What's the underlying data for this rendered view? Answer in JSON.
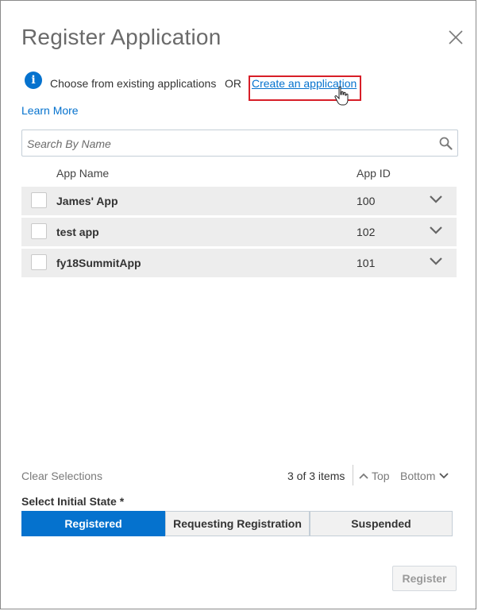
{
  "dialog": {
    "title": "Register Application"
  },
  "info": {
    "choose_text": "Choose from existing applications",
    "or_text": "OR",
    "create_link": "Create an application",
    "learn_more": "Learn More"
  },
  "search": {
    "placeholder": "Search By Name",
    "value": ""
  },
  "table": {
    "columns": [
      "App Name",
      "App ID"
    ],
    "rows": [
      {
        "name": "James' App",
        "id": "100"
      },
      {
        "name": "test app",
        "id": "102"
      },
      {
        "name": "fy18SummitApp",
        "id": "101"
      }
    ]
  },
  "footer": {
    "clear_selections": "Clear Selections",
    "items_count": "3 of 3 items",
    "top": "Top",
    "bottom": "Bottom"
  },
  "state": {
    "label": "Select Initial State *",
    "options": [
      "Registered",
      "Requesting Registration",
      "Suspended"
    ],
    "selected": "Registered"
  },
  "actions": {
    "register": "Register"
  },
  "colors": {
    "accent": "#0572ce",
    "highlight": "#d71e28",
    "row_bg": "#ededed"
  }
}
